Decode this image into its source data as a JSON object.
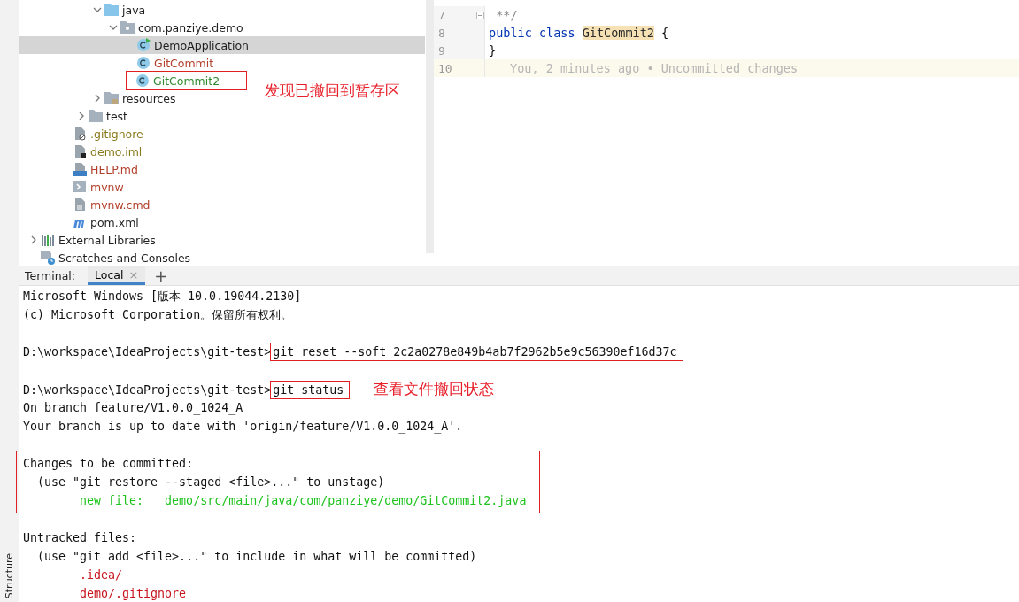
{
  "tree": [
    {
      "children": [
        {
          "children": [
            {
              "children": [
                {
                  "children": [
                    {
                      "label": "java",
                      "kind": "source-folder",
                      "expanded": true,
                      "children": [
                        {
                          "label": "com.panziye.demo",
                          "kind": "package",
                          "expanded": true,
                          "children": [
                            {
                              "label": "DemoApplication",
                              "kind": "run-class",
                              "color": "#1e1e1e",
                              "selected": true
                            },
                            {
                              "label": "GitCommit",
                              "kind": "class",
                              "color": "#b3402c",
                              "selected": false
                            },
                            {
                              "label": "GitCommit2",
                              "kind": "class",
                              "color": "#2f8a2f",
                              "selected": false,
                              "boxed": true,
                              "note": "发现已撤回到暂存区"
                            }
                          ]
                        }
                      ]
                    },
                    {
                      "label": "resources",
                      "kind": "resources-folder",
                      "expanded": false
                    }
                  ]
                },
                {
                  "label": "test",
                  "kind": "folder",
                  "expanded": false
                }
              ]
            },
            {
              "label": ".gitignore",
              "kind": "file-ignore",
              "color": "#8a7a1c",
              "selected": false
            },
            {
              "label": "demo.iml",
              "kind": "file-iml",
              "color": "#8a7a1c",
              "selected": false
            },
            {
              "label": "HELP.md",
              "kind": "file-md",
              "color": "#b3402c",
              "selected": false
            },
            {
              "label": "mvnw",
              "kind": "file-exe",
              "color": "#b3402c",
              "selected": false
            },
            {
              "label": "mvnw.cmd",
              "kind": "file-text",
              "color": "#b3402c",
              "selected": false
            },
            {
              "label": "pom.xml",
              "kind": "maven",
              "color": "#1e1e1e",
              "selected": false
            }
          ]
        }
      ]
    },
    {
      "label": "External Libraries",
      "kind": "libraries",
      "expanded": false
    },
    {
      "label": "Scratches and Consoles",
      "kind": "scratches"
    }
  ],
  "editor": {
    "lines": [
      {
        "number": "7",
        "fold": true,
        "tokens": [
          {
            "text": " **/",
            "kind": "comment"
          }
        ]
      },
      {
        "number": "8",
        "tokens": [
          {
            "text": "public class ",
            "kind": "keyword"
          },
          {
            "text": "GitCommit2",
            "kind": "highlight"
          },
          {
            "text": " {",
            "kind": "plain"
          }
        ]
      },
      {
        "number": "9",
        "tokens": [
          {
            "text": "}",
            "kind": "plain"
          }
        ]
      },
      {
        "number": "10",
        "current": true,
        "tokens": [
          {
            "text": "You, 2 minutes ago • Uncommitted changes",
            "kind": "hint"
          }
        ]
      }
    ]
  },
  "terminal": {
    "label": "Terminal:",
    "tabs": [
      {
        "label": "Local",
        "selected": true,
        "close": "×"
      }
    ],
    "add": "+",
    "lines": [
      {
        "kind": "text",
        "text": "Microsoft Windows [版本 10.0.19044.2130]"
      },
      {
        "kind": "text",
        "text": "(c) Microsoft Corporation。保留所有权利。"
      },
      {
        "kind": "blank"
      },
      {
        "kind": "command",
        "prompt": "D:\\workspace\\IdeaProjects\\git-test>",
        "command": "git reset --soft 2c2a0278e849b4ab7f2962b5e9c56390ef16d37c",
        "boxed": true
      },
      {
        "kind": "blank"
      },
      {
        "kind": "command",
        "prompt": "D:\\workspace\\IdeaProjects\\git-test>",
        "command": "git status",
        "boxed": true,
        "note": "查看文件撤回状态"
      },
      {
        "kind": "text",
        "text": "On branch feature/V1.0.0_1024_A"
      },
      {
        "kind": "text",
        "text": "Your branch is up to date with 'origin/feature/V1.0.0_1024_A'."
      },
      {
        "kind": "blank"
      },
      {
        "kind": "group",
        "boxed": true,
        "lines": [
          {
            "kind": "text",
            "text": "Changes to be committed:"
          },
          {
            "kind": "text",
            "text": "  (use \"git restore --staged <file>...\" to unstage)"
          },
          {
            "kind": "text",
            "text": "        new file:   demo/src/main/java/com/panziye/demo/GitCommit2.java",
            "color": "#1dc41d"
          }
        ]
      },
      {
        "kind": "blank"
      },
      {
        "kind": "text",
        "text": "Untracked files:"
      },
      {
        "kind": "text",
        "text": "  (use \"git add <file>...\" to include in what will be committed)"
      },
      {
        "kind": "text",
        "text": "        .idea/",
        "color": "#c8161e"
      },
      {
        "kind": "text",
        "text": "        demo/.gitignore",
        "color": "#c8161e"
      }
    ]
  },
  "side_strip": {
    "label": "Structure"
  }
}
